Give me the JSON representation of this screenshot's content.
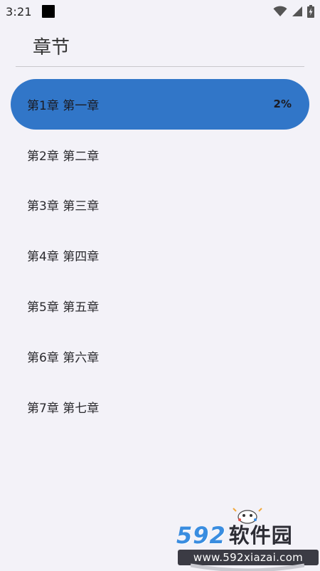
{
  "status_bar": {
    "time": "3:21",
    "icons": [
      "notification-square-icon",
      "wifi-icon",
      "cellular-signal-icon",
      "battery-icon"
    ]
  },
  "header": {
    "title": "章节"
  },
  "chapters": [
    {
      "label": "第1章 第一章",
      "progress": "2%",
      "active": true
    },
    {
      "label": "第2章 第二章",
      "progress": "",
      "active": false
    },
    {
      "label": "第3章 第三章",
      "progress": "",
      "active": false
    },
    {
      "label": "第4章 第四章",
      "progress": "",
      "active": false
    },
    {
      "label": "第5章 第五章",
      "progress": "",
      "active": false
    },
    {
      "label": "第6章 第六章",
      "progress": "",
      "active": false
    },
    {
      "label": "第7章 第七章",
      "progress": "",
      "active": false
    }
  ],
  "colors": {
    "background": "#f3f2f8",
    "active_item": "#3176c8",
    "divider": "#c8c8cc"
  },
  "watermark": {
    "logo_number": "592",
    "logo_text": "软件园",
    "url": "www.592xiazai.com"
  }
}
